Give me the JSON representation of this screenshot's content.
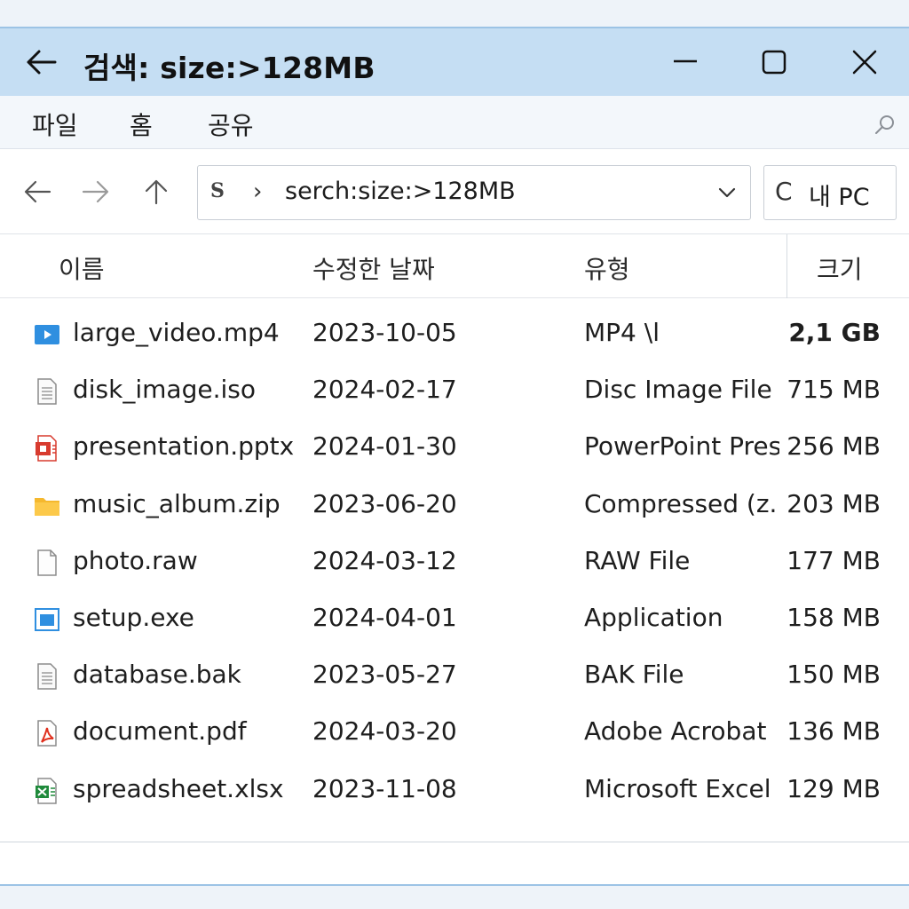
{
  "titlebar": {
    "title": "검색: size:>128MB",
    "icons": {
      "back": "back-arrow-icon",
      "minimize": "minimize-icon",
      "maximize": "maximize-icon",
      "close": "close-icon"
    }
  },
  "menu": {
    "items": [
      "파일",
      "홈",
      "공유"
    ],
    "search_icon": "search-icon"
  },
  "nav": {
    "address_icon_text": "S",
    "address_text": "serch:size:>128MB",
    "search_box_text": "내 PC",
    "search_box_icon": "C"
  },
  "columns": {
    "name": "이름",
    "date": "수정한 날짜",
    "type": "유형",
    "size": "크기"
  },
  "files": [
    {
      "name": "large_video.mp4",
      "date": "2023-10-05",
      "type": "MP4 \\l",
      "size": "2,1 GB",
      "icon": "video-file-icon",
      "bold_size": true
    },
    {
      "name": "disk_image.iso",
      "date": "2024-02-17",
      "type": "Disc Image File",
      "size": "715 MB",
      "icon": "document-file-icon"
    },
    {
      "name": "presentation.pptx",
      "date": "2024-01-30",
      "type": "PowerPoint Pres",
      "size": "256 MB",
      "icon": "powerpoint-file-icon"
    },
    {
      "name": "music_album.zip",
      "date": "2023-06-20",
      "type": "Compressed (z...",
      "size": "203 MB",
      "icon": "folder-zip-icon"
    },
    {
      "name": "photo.raw",
      "date": "2024-03-12",
      "type": "RAW File",
      "size": "177 MB",
      "icon": "blank-file-icon"
    },
    {
      "name": "setup.exe",
      "date": "2024-04-01",
      "type": "Application",
      "size": "158 MB",
      "icon": "application-icon"
    },
    {
      "name": "database.bak",
      "date": "2023-05-27",
      "type": "BAK File",
      "size": "150 MB",
      "icon": "document-file-icon"
    },
    {
      "name": "document.pdf",
      "date": "2024-03-20",
      "type": "Adobe Acrobat",
      "size": "136 MB",
      "icon": "pdf-file-icon"
    },
    {
      "name": "spreadsheet.xlsx",
      "date": "2023-11-08",
      "type": "Microsoft Excel",
      "size": "129 MB",
      "icon": "excel-file-icon"
    }
  ],
  "colors": {
    "titlebar_bg": "#c5def3",
    "menubar_bg": "#f3f7fb",
    "video_blue": "#2f8fe0",
    "ppt_red": "#d83b2f",
    "zip_yellow": "#f5b82e",
    "pdf_red": "#e0301e",
    "excel_green": "#1f8a3b"
  }
}
